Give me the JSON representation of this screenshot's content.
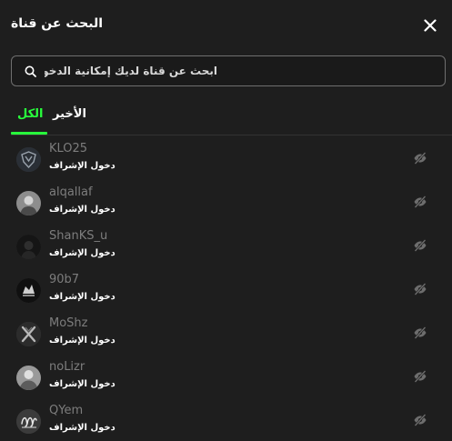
{
  "header": {
    "title": "البحث عن قناة"
  },
  "search": {
    "placeholder": "ابحث عن قناة لديك إمكانية الدخول لها",
    "value": ""
  },
  "tabs": {
    "all_label": "الكل",
    "recent_label": "الأخير",
    "active_color": "#28ff3c"
  },
  "channels": [
    {
      "name": "KLO25",
      "action": "دخول الإشراف",
      "avatar": "dark-emblem"
    },
    {
      "name": "alqallaf",
      "action": "دخول الإشراف",
      "avatar": "person-photo"
    },
    {
      "name": "ShanKS_u",
      "action": "دخول الإشراف",
      "avatar": "dark-photo"
    },
    {
      "name": "90b7",
      "action": "دخول الإشراف",
      "avatar": "dark-logo"
    },
    {
      "name": "MoShz",
      "action": "دخول الإشراف",
      "avatar": "x-emblem"
    },
    {
      "name": "noLizr",
      "action": "دخول الإشراف",
      "avatar": "person-photo"
    },
    {
      "name": "QYem",
      "action": "دخول الإشراف",
      "avatar": "script-logo"
    }
  ],
  "icons": {
    "close": "close-icon",
    "search": "search-icon",
    "row_action": "eye-slash-icon"
  }
}
